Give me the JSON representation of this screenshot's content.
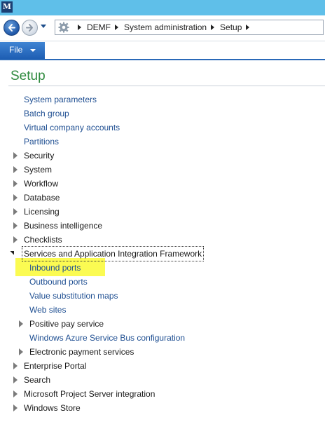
{
  "titlebar": {
    "logo_text": "M"
  },
  "nav": {
    "back_icon": "back-arrow-icon",
    "forward_icon": "forward-arrow-icon",
    "breadcrumb": [
      "DEMF",
      "System administration",
      "Setup"
    ]
  },
  "menu": {
    "file_label": "File"
  },
  "page": {
    "title": "Setup"
  },
  "tree": {
    "items": [
      {
        "label": "System parameters",
        "type": "link"
      },
      {
        "label": "Batch group",
        "type": "link"
      },
      {
        "label": "Virtual company accounts",
        "type": "link"
      },
      {
        "label": "Partitions",
        "type": "link"
      },
      {
        "label": "Security",
        "type": "collapsed"
      },
      {
        "label": "System",
        "type": "collapsed"
      },
      {
        "label": "Workflow",
        "type": "collapsed"
      },
      {
        "label": "Database",
        "type": "collapsed"
      },
      {
        "label": "Licensing",
        "type": "collapsed"
      },
      {
        "label": "Business intelligence",
        "type": "collapsed"
      },
      {
        "label": "Checklists",
        "type": "collapsed"
      },
      {
        "label": "Services and Application Integration Framework",
        "type": "expanded"
      },
      {
        "label": "Inbound ports",
        "type": "link",
        "highlighted": true
      },
      {
        "label": "Outbound ports",
        "type": "link"
      },
      {
        "label": "Value substitution maps",
        "type": "link"
      },
      {
        "label": "Web sites",
        "type": "link"
      },
      {
        "label": "Positive pay service",
        "type": "collapsed"
      },
      {
        "label": "Windows Azure Service Bus configuration",
        "type": "link"
      },
      {
        "label": "Electronic payment services",
        "type": "collapsed"
      },
      {
        "label": "Enterprise Portal",
        "type": "collapsed"
      },
      {
        "label": "Search",
        "type": "collapsed"
      },
      {
        "label": "Microsoft Project Server integration",
        "type": "collapsed"
      },
      {
        "label": "Windows Store",
        "type": "collapsed"
      }
    ]
  },
  "colors": {
    "titlebar": "#5fbfe9",
    "link": "#1f4f92",
    "title": "#2e8a3e",
    "highlight": "#fbfb52",
    "file_button": "#2a69b8"
  }
}
